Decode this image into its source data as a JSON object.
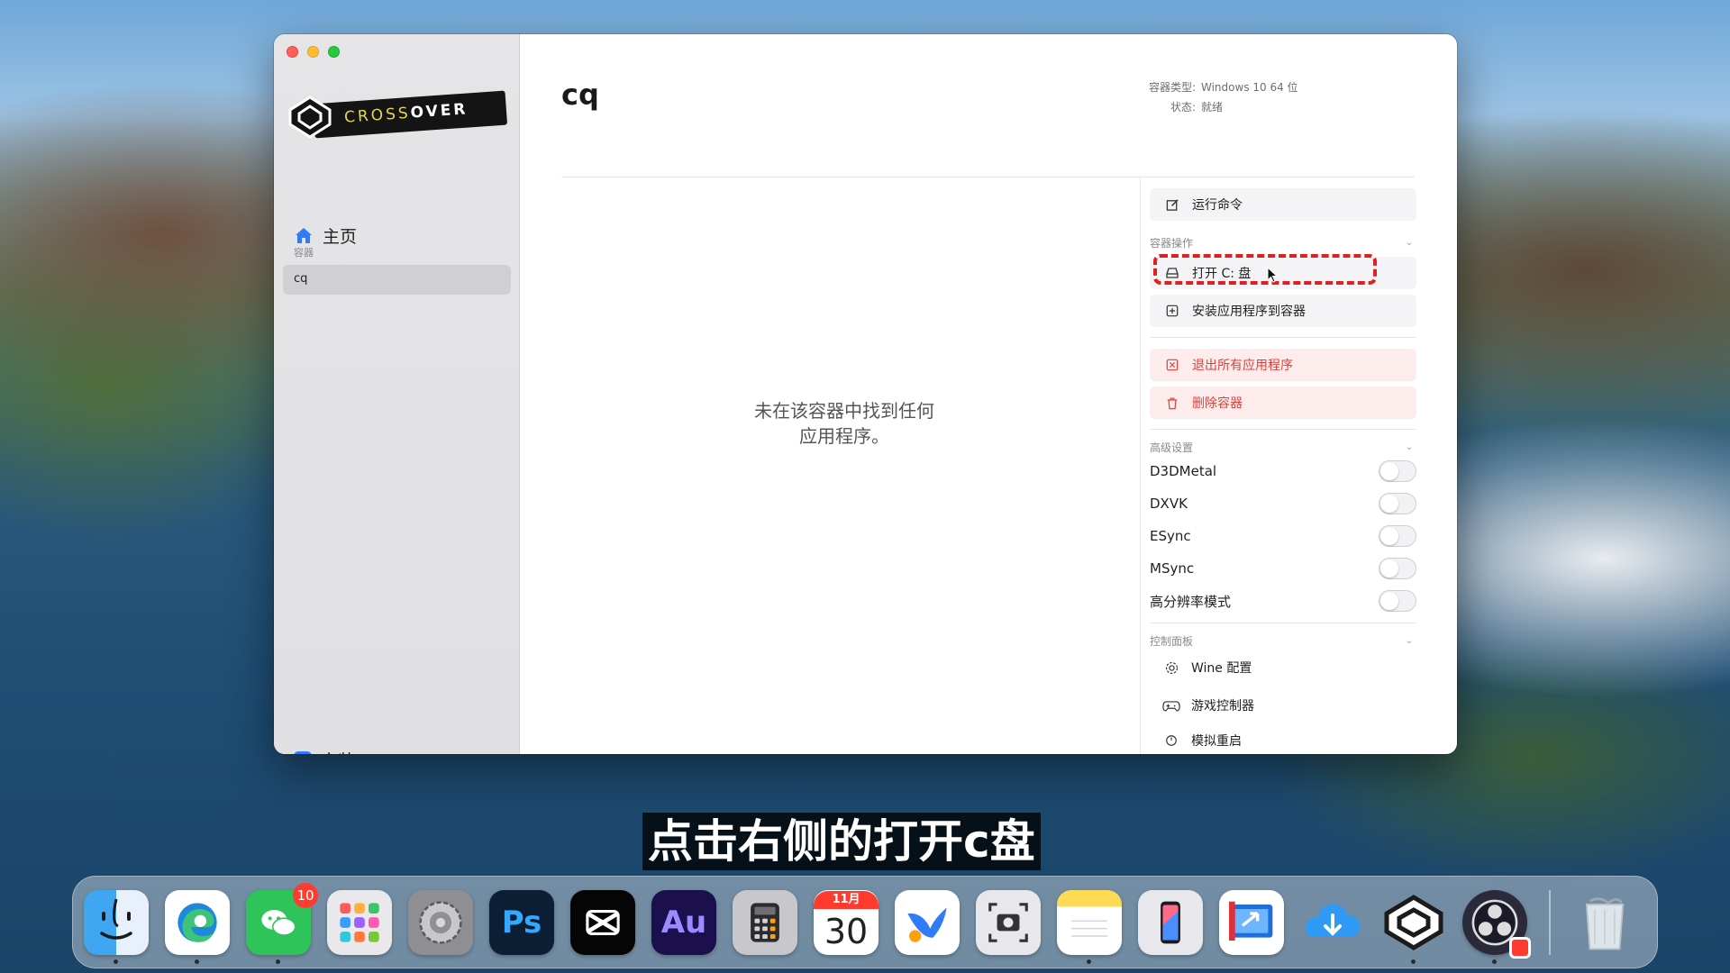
{
  "sidebar": {
    "logo_text_a": "CROSS",
    "logo_text_b": "OVER",
    "home_label": "主页",
    "section_label": "容器",
    "container_name": "cq",
    "install_label": "安装"
  },
  "main": {
    "title": "cq",
    "meta": [
      {
        "key": "容器类型:",
        "value": "Windows 10 64 位"
      },
      {
        "key": "状态:",
        "value": "就绪"
      }
    ],
    "empty_line1": "未在该容器中找到任何",
    "empty_line2": "应用程序。"
  },
  "panel": {
    "run_command": "运行命令",
    "container_ops_label": "容器操作",
    "open_c_drive": "打开 C: 盘",
    "install_app": "安装应用程序到容器",
    "quit_all": "退出所有应用程序",
    "delete_container": "删除容器",
    "advanced_label": "高级设置",
    "toggles": [
      {
        "label": "D3DMetal",
        "on": false
      },
      {
        "label": "DXVK",
        "on": false
      },
      {
        "label": "ESync",
        "on": false
      },
      {
        "label": "MSync",
        "on": false
      },
      {
        "label": "高分辨率模式",
        "on": false
      }
    ],
    "control_panel_label": "控制面板",
    "wine_config": "Wine 配置",
    "game_controller": "游戏控制器",
    "simulate_restart": "模拟重启"
  },
  "subtitle": "点击右侧的打开c盘",
  "dock": {
    "wechat_badge": "10",
    "ps_label": "Ps",
    "au_label": "Au",
    "calendar_month": "11月",
    "calendar_day": "30"
  },
  "colors": {
    "accent": "#2f7cf6",
    "danger": "#e0403b",
    "highlight": "#e02020"
  }
}
